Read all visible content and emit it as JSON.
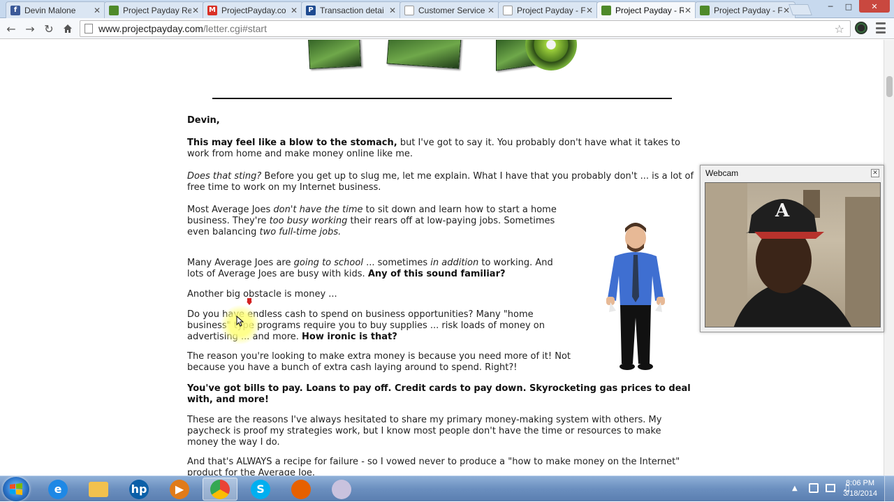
{
  "browser": {
    "tabs": [
      {
        "label": "Devin Malone",
        "favicon": "facebook-favicon",
        "color": "#3b5998",
        "glyph": "f",
        "active": false
      },
      {
        "label": "Project Payday Re",
        "favicon": "projectpayday-favicon",
        "color": "#4f8a2a",
        "glyph": "",
        "active": false
      },
      {
        "label": "ProjectPayday.co",
        "favicon": "gmail-favicon",
        "color": "#d93025",
        "glyph": "M",
        "active": false
      },
      {
        "label": "Transaction detai",
        "favicon": "paypal-favicon",
        "color": "#1f4b91",
        "glyph": "P",
        "active": false
      },
      {
        "label": "Customer Service",
        "favicon": "page-favicon",
        "color": "#ffffff",
        "glyph": "",
        "active": false
      },
      {
        "label": "Project Payday - F",
        "favicon": "page-favicon",
        "color": "#ffffff",
        "glyph": "",
        "active": false
      },
      {
        "label": "Project Payday - R",
        "favicon": "projectpayday-favicon",
        "color": "#4f8a2a",
        "glyph": "",
        "active": true
      },
      {
        "label": "Project Payday - F",
        "favicon": "projectpayday-favicon",
        "color": "#4f8a2a",
        "glyph": "",
        "active": false
      }
    ],
    "url_domain": "www.projectpayday.com",
    "url_path": "/letter.cgi#start"
  },
  "letter": {
    "greeting": "Devin,",
    "p1_bold": "This may feel like a blow to the stomach,",
    "p1_rest": " but I've got to say it. You probably don't have what it takes to work from home and make money online like me.",
    "p2_italic": "Does that sting?",
    "p2_rest": " Before you get up to slug me, let me explain. What I have that you probably don't ... is a lot of free time to work on my Internet business.",
    "p3_a": "Most Average Joes ",
    "p3_i1": "don't have the time",
    "p3_b": " to sit down and learn how to start a home business. They're ",
    "p3_i2": "too busy working",
    "p3_c": " their rears off at low-paying jobs. Sometimes even balancing ",
    "p3_i3": "two full-time jobs.",
    "p4_a": "Many Average Joes are ",
    "p4_i1": "going to school",
    "p4_b": " ... sometimes ",
    "p4_i2": "in addition",
    "p4_c": " to working. And lots of Average Joes are busy with kids. ",
    "p4_bold": "Any of this sound familiar?",
    "p5": "Another big obstacle is money ...",
    "p6_a": "Do you have endless cash to spend on business opportunities? Many \"home business\" type programs require you to buy supplies ... risk loads of money on advertising ... and more. ",
    "p6_bold": "How ironic is that?",
    "p7": "The reason you're looking to make extra money is because you need more of it! Not because you have a bunch of extra cash laying around to spend. Right?!",
    "p8_bold": "You've got bills to pay. Loans to pay off. Credit cards to pay down. Skyrocketing gas prices to deal with, and more!",
    "p9": "These are the reasons I've always hesitated to share my primary money-making system with others. My paycheck is proof my strategies work, but I know most people don't have the time or resources to make money the way I do.",
    "p10": "And that's ALWAYS a recipe for failure - so I vowed never to produce a \"how to make money on the Internet\" product for the Average Joe."
  },
  "webcam": {
    "title": "Webcam",
    "close_glyph": "✕"
  },
  "taskbar": {
    "apps": [
      {
        "name": "internet-explorer",
        "glyph": "e",
        "color": "#1e88e5",
        "active": false
      },
      {
        "name": "file-explorer",
        "glyph": "",
        "color": "#f2c14e",
        "active": false
      },
      {
        "name": "hp",
        "glyph": "hp",
        "color": "#0a5fa8",
        "active": false
      },
      {
        "name": "media-player",
        "glyph": "▶",
        "color": "#e07b1a",
        "active": false
      },
      {
        "name": "chrome",
        "glyph": "",
        "color": "#34a853",
        "active": true
      },
      {
        "name": "skype",
        "glyph": "S",
        "color": "#00aff0",
        "active": false
      },
      {
        "name": "firefox",
        "glyph": "",
        "color": "#e66000",
        "active": false
      },
      {
        "name": "screen-recorder",
        "glyph": "",
        "color": "#c9c2de",
        "active": false
      }
    ],
    "time": "8:06 PM",
    "date": "3/18/2014"
  }
}
